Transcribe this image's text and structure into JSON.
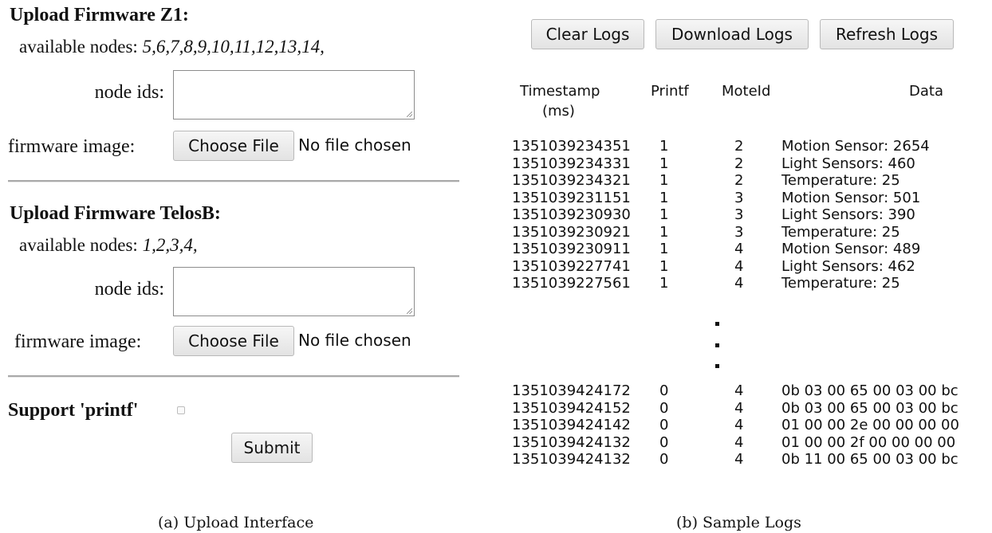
{
  "upload": {
    "z1": {
      "title": "Upload Firmware Z1:",
      "available_label": "available nodes:",
      "available_nodes": "5,6,7,8,9,10,11,12,13,14,",
      "node_ids_label": "node ids:",
      "node_ids_value": "",
      "firmware_label": "firmware image:",
      "choose_file": "Choose File",
      "no_file": "No file chosen"
    },
    "telosb": {
      "title": "Upload Firmware TelosB:",
      "available_label": "available nodes:",
      "available_nodes": "1,2,3,4,",
      "node_ids_label": "node ids:",
      "node_ids_value": "",
      "firmware_label": "firmware image:",
      "choose_file": "Choose File",
      "no_file": "No file chosen"
    },
    "printf_label": "Support 'printf'",
    "printf_checked": false,
    "submit": "Submit",
    "caption": "(a) Upload Interface"
  },
  "logs": {
    "buttons": {
      "clear": "Clear Logs",
      "download": "Download Logs",
      "refresh": "Refresh Logs"
    },
    "columns": {
      "timestamp": "Timestamp",
      "timestamp_unit": "(ms)",
      "printf": "Printf",
      "moteid": "MoteId",
      "data": "Data"
    },
    "rows_top": [
      [
        "1351039234351",
        "1",
        "2",
        "Motion Sensor: 2654"
      ],
      [
        "1351039234331",
        "1",
        "2",
        "Light Sensors: 460"
      ],
      [
        "1351039234321",
        "1",
        "2",
        "Temperature: 25"
      ],
      [
        "1351039231151",
        "1",
        "3",
        "Motion Sensor: 501"
      ],
      [
        "1351039230930",
        "1",
        "3",
        "Light Sensors: 390"
      ],
      [
        "1351039230921",
        "1",
        "3",
        "Temperature: 25"
      ],
      [
        "1351039230911",
        "1",
        "4",
        "Motion Sensor: 489"
      ],
      [
        "1351039227741",
        "1",
        "4",
        "Light Sensors: 462"
      ],
      [
        "1351039227561",
        "1",
        "4",
        "Temperature: 25"
      ]
    ],
    "rows_bottom": [
      [
        "1351039424172",
        "0",
        "4",
        "0b 03 00 65 00 03 00 bc"
      ],
      [
        "1351039424152",
        "0",
        "4",
        "0b 03 00 65 00 03 00 bc"
      ],
      [
        "1351039424142",
        "0",
        "4",
        "01 00 00 2e 00 00 00 00"
      ],
      [
        "1351039424132",
        "0",
        "4",
        "01 00 00 2f 00 00 00 00"
      ],
      [
        "1351039424132",
        "0",
        "4",
        "0b 11 00 65 00 03 00 bc"
      ]
    ],
    "caption": "(b) Sample Logs"
  }
}
